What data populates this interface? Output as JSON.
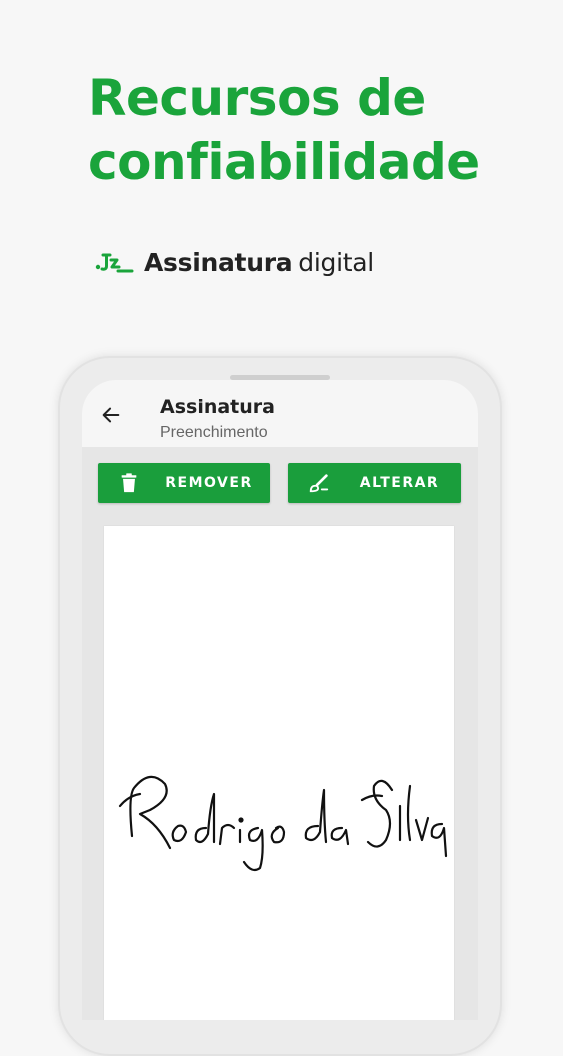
{
  "headline": {
    "line1": "Recursos de",
    "line2": "confiabilidade"
  },
  "feature": {
    "bold": "Assinatura",
    "light": "digital",
    "icon": "signature-pen-icon"
  },
  "app": {
    "title": "Assinatura",
    "subtitle": "Preenchimento",
    "back_icon": "arrow-left-icon",
    "buttons": {
      "remove": {
        "label": "REMOVER",
        "icon": "trash-icon"
      },
      "alter": {
        "label": "ALTERAR",
        "icon": "brush-icon"
      }
    },
    "signature_text": "Rodrigo da Silva"
  },
  "colors": {
    "brand_green": "#1aa43b",
    "button_green": "#1a9e3c"
  }
}
